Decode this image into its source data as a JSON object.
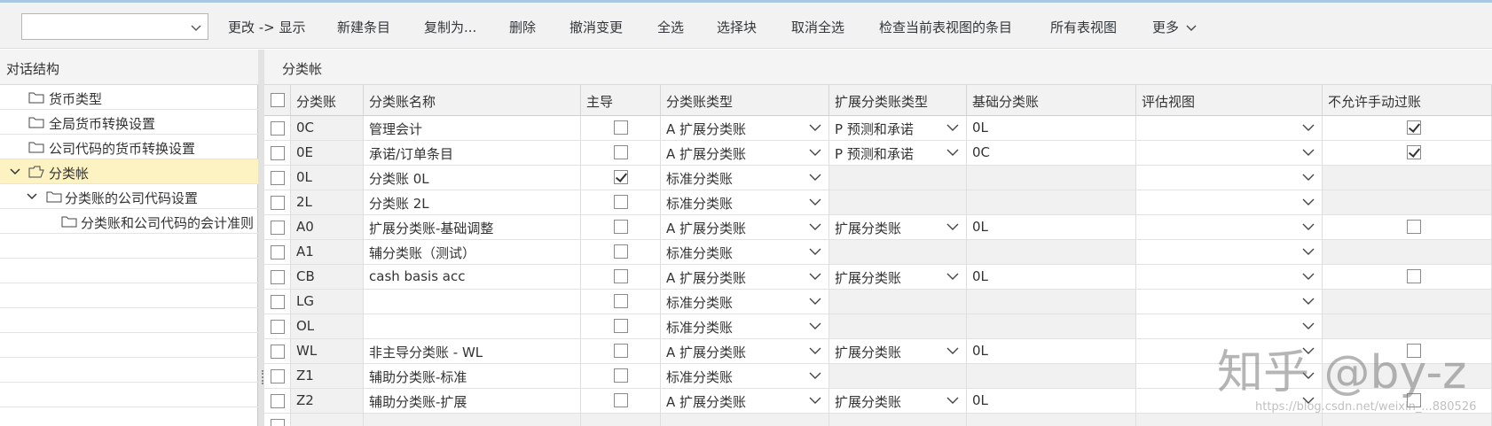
{
  "toolbar": {
    "select_value": "",
    "buttons": [
      "更改 -> 显示",
      "新建条目",
      "复制为...",
      "删除",
      "撤消变更",
      "全选",
      "选择块",
      "取消全选",
      "检查当前表视图的条目",
      "所有表视图",
      "更多"
    ]
  },
  "tree": {
    "title": "对话结构",
    "items": [
      {
        "label": "货币类型"
      },
      {
        "label": "全局货币转换设置"
      },
      {
        "label": "公司代码的货币转换设置"
      },
      {
        "label": "分类帐",
        "selected": true
      },
      {
        "label": "分类账的公司代码设置"
      },
      {
        "label": "分类账和公司代码的会计准则"
      }
    ]
  },
  "table": {
    "title": "分类帐",
    "columns": [
      "分类账",
      "分类账名称",
      "主导",
      "分类账类型",
      "扩展分类账类型",
      "基础分类账",
      "评估视图",
      "不允许手动过账"
    ],
    "rows": [
      {
        "ledger": "0C",
        "name": "管理会计",
        "leading": false,
        "type": "A 扩展分类账",
        "ext_type": "P 预测和承诺",
        "base": "0L",
        "manual": true
      },
      {
        "ledger": "0E",
        "name": "承诺/订单条目",
        "leading": false,
        "type": "A 扩展分类账",
        "ext_type": "P 预测和承诺",
        "base": "0C",
        "manual": true
      },
      {
        "ledger": "0L",
        "name": "分类账 0L",
        "leading": true,
        "type": "标准分类账",
        "ext_type": "",
        "base": "",
        "manual": null
      },
      {
        "ledger": "2L",
        "name": "分类账 2L",
        "leading": false,
        "type": "标准分类账",
        "ext_type": "",
        "base": "",
        "manual": null
      },
      {
        "ledger": "A0",
        "name": "扩展分类账-基础调整",
        "leading": false,
        "type": "A 扩展分类账",
        "ext_type": "扩展分类账",
        "base": "0L",
        "manual": false
      },
      {
        "ledger": "A1",
        "name": "辅分类账（测试）",
        "leading": false,
        "type": "标准分类账",
        "ext_type": "",
        "base": "",
        "manual": null
      },
      {
        "ledger": "CB",
        "name": "cash basis acc",
        "leading": false,
        "type": "A 扩展分类账",
        "ext_type": "扩展分类账",
        "base": "0L",
        "manual": false
      },
      {
        "ledger": "LG",
        "name": "",
        "leading": false,
        "type": "标准分类账",
        "ext_type": "",
        "base": "",
        "manual": null
      },
      {
        "ledger": "OL",
        "name": "",
        "leading": false,
        "type": "标准分类账",
        "ext_type": "",
        "base": "",
        "manual": null
      },
      {
        "ledger": "WL",
        "name": "非主导分类账 - WL",
        "leading": false,
        "type": "A 扩展分类账",
        "ext_type": "扩展分类账",
        "base": "0L",
        "manual": false
      },
      {
        "ledger": "Z1",
        "name": "辅助分类账-标准",
        "leading": false,
        "type": "标准分类账",
        "ext_type": "",
        "base": "",
        "manual": null
      },
      {
        "ledger": "Z2",
        "name": "辅助分类账-扩展",
        "leading": false,
        "type": "A 扩展分类账",
        "ext_type": "扩展分类账",
        "base": "0L",
        "manual": false
      }
    ]
  },
  "watermark": {
    "text": "知乎 @by-z",
    "url": "https://blog.csdn.net/weixin_...880526"
  }
}
